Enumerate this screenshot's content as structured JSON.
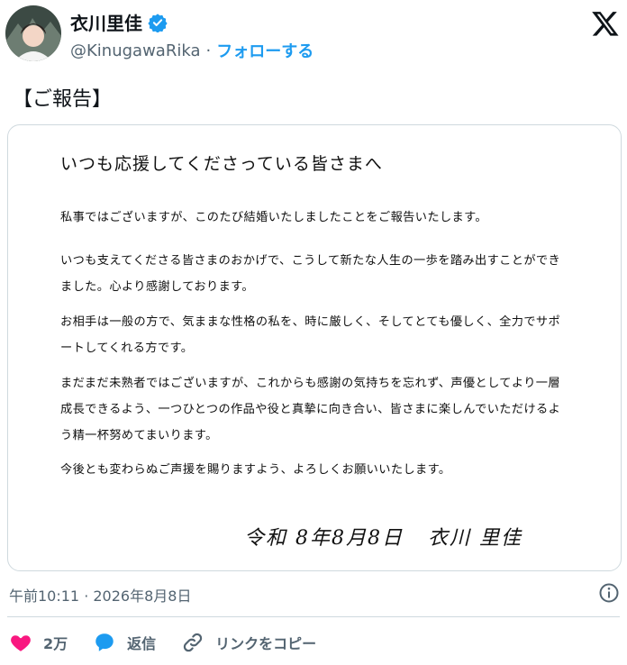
{
  "profile": {
    "name": "衣川里佳",
    "handle": "@KinugawaRika",
    "separator": "·",
    "follow_label": "フォローする"
  },
  "tweet": {
    "text": "【ご報告】"
  },
  "letter": {
    "greeting": "いつも応援してくださっている皆さまへ",
    "paragraphs": [
      "私事ではございますが、このたび結婚いたしましたことをご報告いたします。",
      "いつも支えてくださる皆さまのおかげで、こうして新たな人生の一歩を踏み出すことができました。心より感謝しております。",
      "お相手は一般の方で、気ままな性格の私を、時に厳しく、そしてとても優しく、全力でサポートしてくれる方です。",
      "まだまだ未熟者ではございますが、これからも感謝の気持ちを忘れず、声優としてより一層成長できるよう、一つひとつの作品や役と真摯に向き合い、皆さまに楽しんでいただけるよう精一杯努めてまいります。",
      "今後とも変わらぬご声援を賜りますよう、よろしくお願いいたします。"
    ],
    "signature": "令和 8年8月8日   衣川 里佳"
  },
  "meta": {
    "timestamp": "午前10:11 · 2026年8月8日"
  },
  "actions": {
    "likes": "2万",
    "reply_label": "返信",
    "copy_link_label": "リンクをコピー"
  },
  "colors": {
    "accent": "#1d9bf0",
    "like": "#f91880",
    "muted": "#536471",
    "border": "#cfd9de"
  }
}
